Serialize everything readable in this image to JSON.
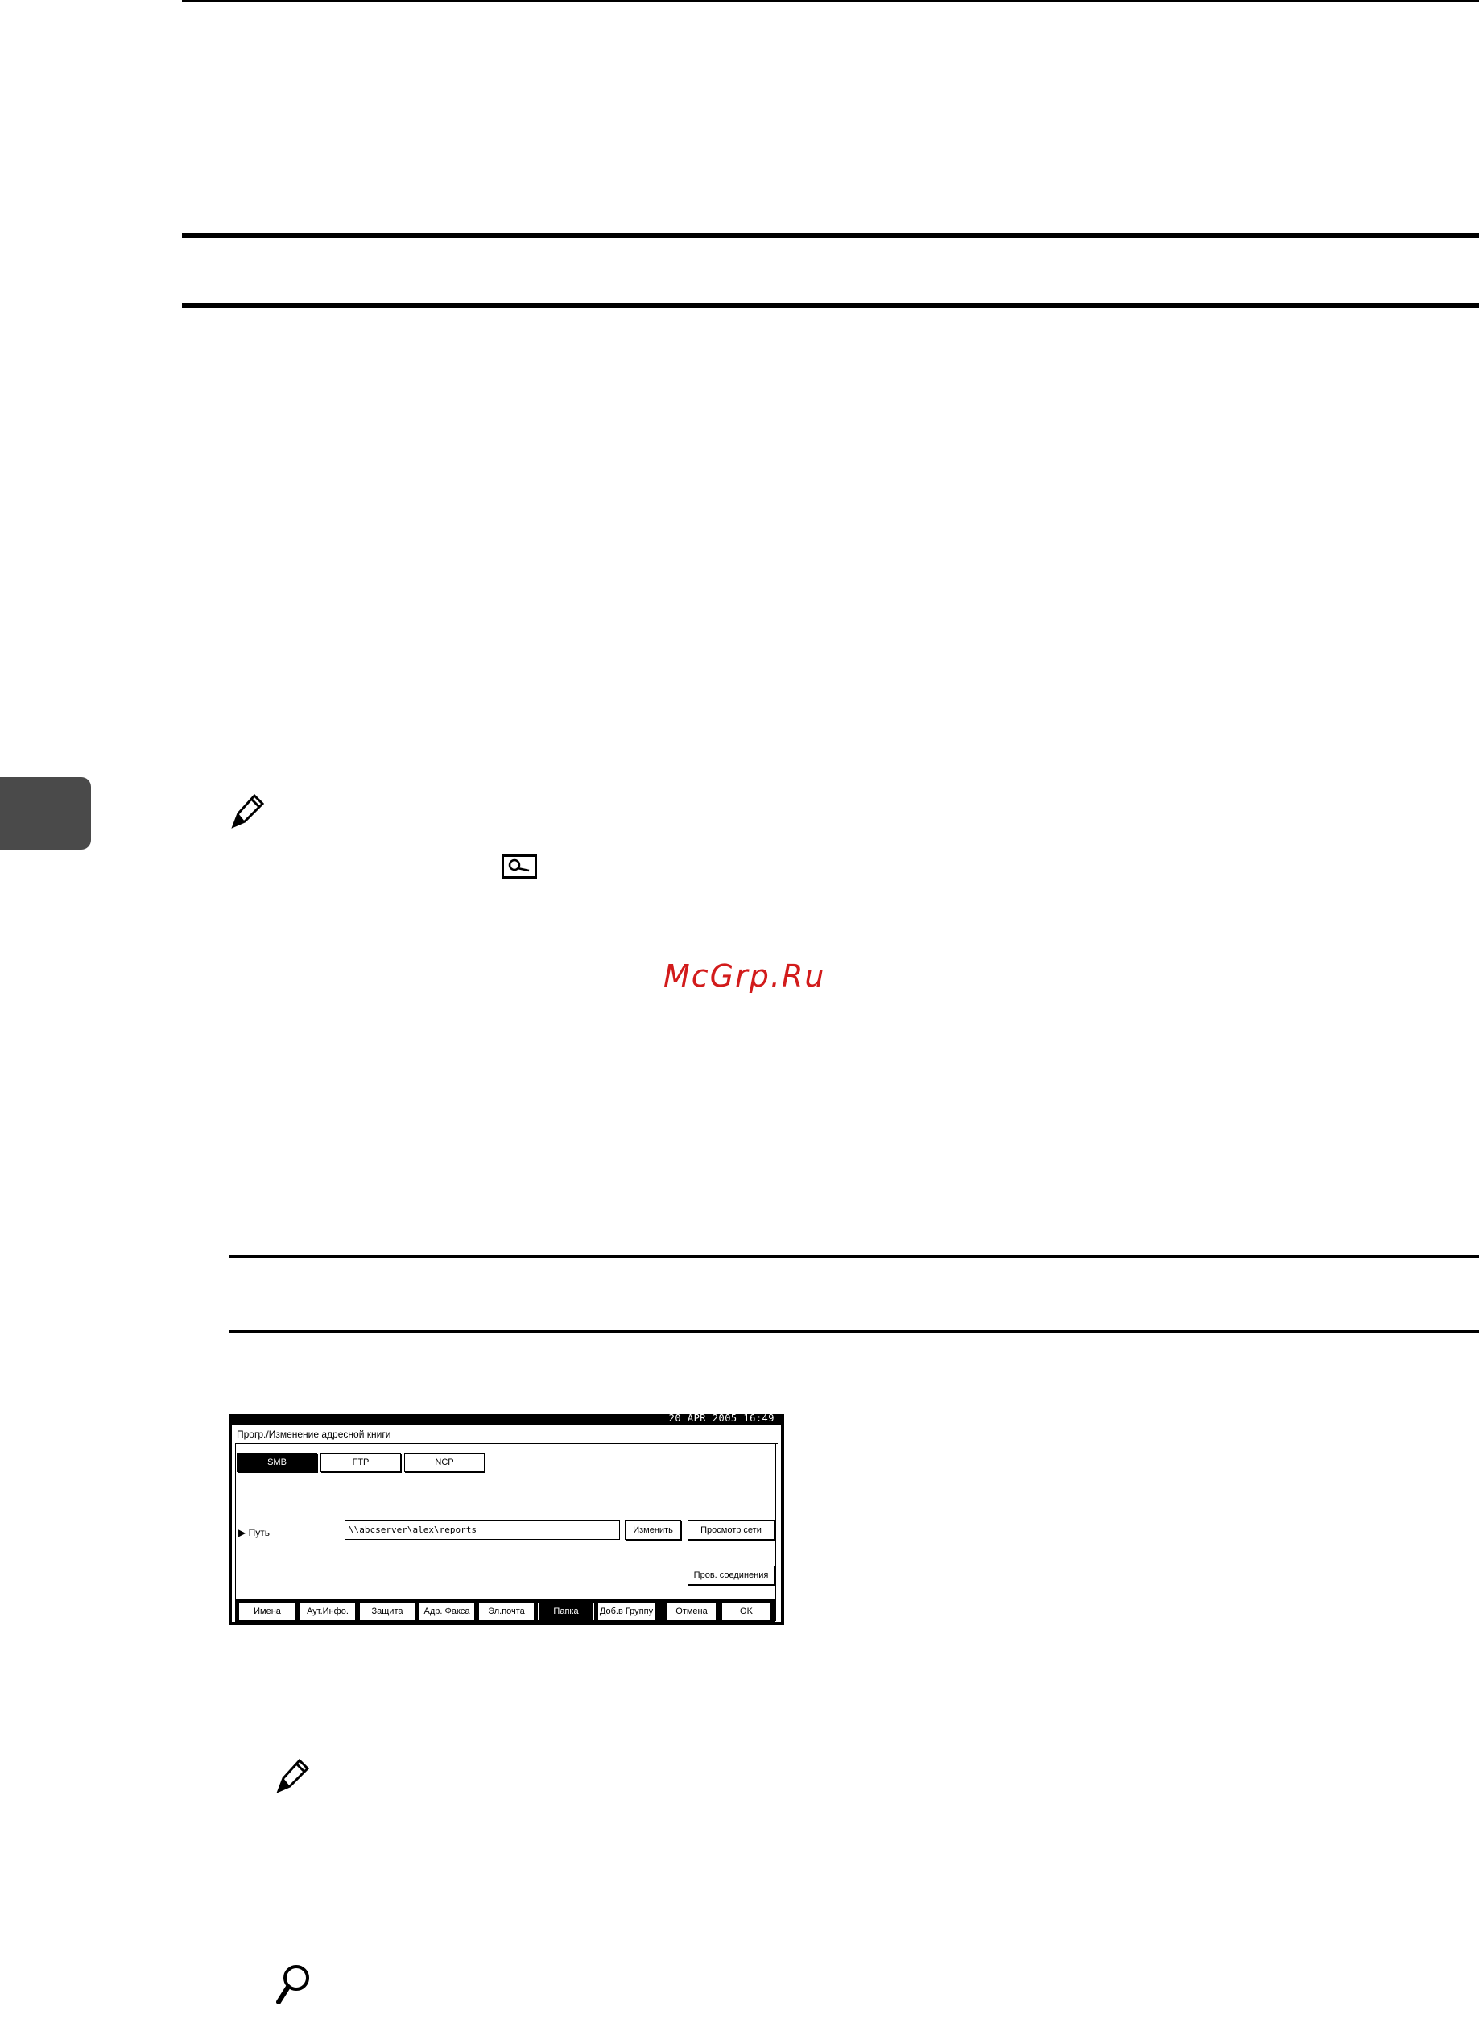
{
  "watermark": "McGrp.Ru",
  "screen": {
    "datetime": "20 APR  2005 16:49",
    "title": "Прогр./Изменение адресной книги",
    "protocol_tabs": [
      {
        "label": "SMB",
        "selected": true
      },
      {
        "label": "FTP",
        "selected": false
      },
      {
        "label": "NCP",
        "selected": false
      }
    ],
    "path_label": "Путь",
    "path_value": "\\\\abcserver\\alex\\reports",
    "change_button": "Изменить",
    "browse_button": "Просмотр сети",
    "connection_test_button": "Пров. соединения",
    "bottom_tabs": [
      {
        "label": "Имена",
        "selected": false
      },
      {
        "label": "Аут.Инфо.",
        "selected": false
      },
      {
        "label": "Защита",
        "selected": false
      },
      {
        "label": "Адр. Факса",
        "selected": false
      },
      {
        "label": "Эл.почта",
        "selected": false
      },
      {
        "label": "Папка",
        "selected": true
      },
      {
        "label": "Доб.в Группу",
        "selected": false
      }
    ],
    "cancel_button": "Отмена",
    "ok_button": "OK"
  }
}
